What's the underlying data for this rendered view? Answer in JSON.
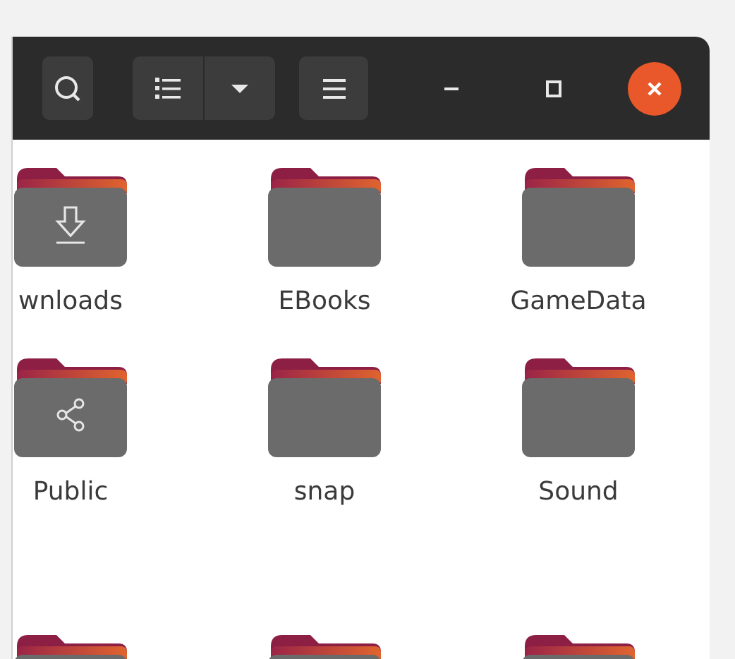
{
  "header": {
    "buttons": [
      {
        "kind": "search"
      },
      {
        "kind": "view-list"
      },
      {
        "kind": "view-dropdown"
      },
      {
        "kind": "menu"
      }
    ],
    "window_controls": [
      {
        "kind": "minimize"
      },
      {
        "kind": "maximize"
      },
      {
        "kind": "close"
      }
    ]
  },
  "folders": [
    {
      "label": "wnloads",
      "kind": "downloads"
    },
    {
      "label": "EBooks",
      "kind": "plain"
    },
    {
      "label": "GameData",
      "kind": "plain"
    },
    {
      "label": "Public",
      "kind": "shared"
    },
    {
      "label": "snap",
      "kind": "plain"
    },
    {
      "label": "Sound",
      "kind": "plain"
    },
    {
      "kind": "plain"
    },
    {
      "kind": "plain"
    },
    {
      "kind": "plain"
    }
  ]
}
